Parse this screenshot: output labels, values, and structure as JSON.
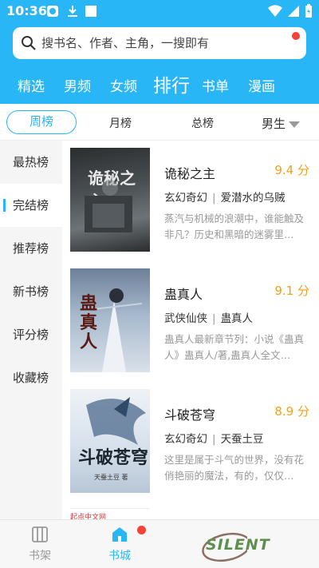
{
  "status_bar": {
    "time": "10:36"
  },
  "search": {
    "placeholder": "搜书名、作者、主角，一搜即有"
  },
  "tabs": [
    "精选",
    "男频",
    "女频",
    "排行",
    "书单",
    "漫画"
  ],
  "active_tab": "排行",
  "filters": {
    "items": [
      "周榜",
      "月榜",
      "总榜"
    ],
    "active": "周榜",
    "gender": "男生"
  },
  "sidebar": {
    "items": [
      "最热榜",
      "完结榜",
      "推荐榜",
      "新书榜",
      "评分榜",
      "收藏榜"
    ],
    "active": "完结榜"
  },
  "books": [
    {
      "title": "诡秘之主",
      "score": "9.4 分",
      "category": "玄幻奇幻",
      "author": "爱潜水的乌贼",
      "desc": "蒸汽与机械的浪潮中，谁能触及非凡？历史和黑暗的迷雾里…",
      "cover_text": "诡秘之主"
    },
    {
      "title": "蛊真人",
      "score": "9.1 分",
      "category": "武侠仙侠",
      "author": "蛊真人",
      "desc": "蛊真人最新章节列：小说《蛊真人》蛊真人/著,蛊真人全文…",
      "cover_text": "蛊真人"
    },
    {
      "title": "斗破苍穹",
      "score": "8.9 分",
      "category": "玄幻奇幻",
      "author": "天蚕土豆",
      "desc": "这里是属于斗气的世界，没有花俏艳丽的魔法，有的，仅仅…",
      "cover_text": "斗破苍穹",
      "cover_sub": "天蚕土豆 著"
    }
  ],
  "partial_item": {
    "tag": "起点中文网"
  },
  "bottom_nav": {
    "items": [
      "书架",
      "书城"
    ],
    "active": "书城"
  },
  "watermark": {
    "text": "SILENT"
  },
  "colors": {
    "primary": "#29b6f6",
    "score": "#f0a020",
    "badge": "#f44336"
  }
}
